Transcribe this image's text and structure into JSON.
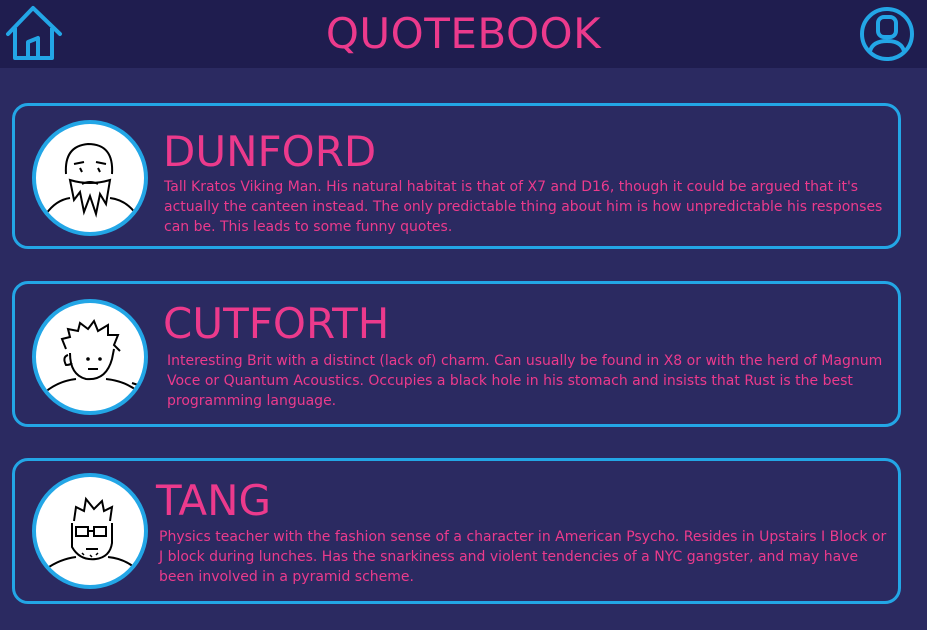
{
  "header": {
    "title": "QUOTEBOOK",
    "home_icon": "home-icon",
    "profile_icon": "user-profile-icon"
  },
  "colors": {
    "background": "#2b2a61",
    "header_background": "#1f1d4f",
    "accent_pink": "#ec3a8c",
    "accent_blue": "#23a6e6"
  },
  "people": [
    {
      "name": "DUNFORD",
      "description": "Tall Kratos Viking Man. His natural habitat is that of X7 and D16, though it could be argued that it's actually the canteen instead. The only predictable thing about him is how unpredictable his responses can be. This leads to some funny quotes."
    },
    {
      "name": "CUTFORTH",
      "description": "Interesting Brit with a distinct (lack of) charm. Can usually be found in X8 or with the herd of Magnum Voce or Quantum Acoustics. Occupies a black hole in his stomach and insists that Rust is the best programming language."
    },
    {
      "name": "TANG",
      "description": "Physics teacher with the fashion sense of a character in American Psycho. Resides in Upstairs I Block or J block during lunches. Has the snarkiness and violent tendencies of a NYC gangster, and may have been involved in a pyramid scheme."
    }
  ]
}
